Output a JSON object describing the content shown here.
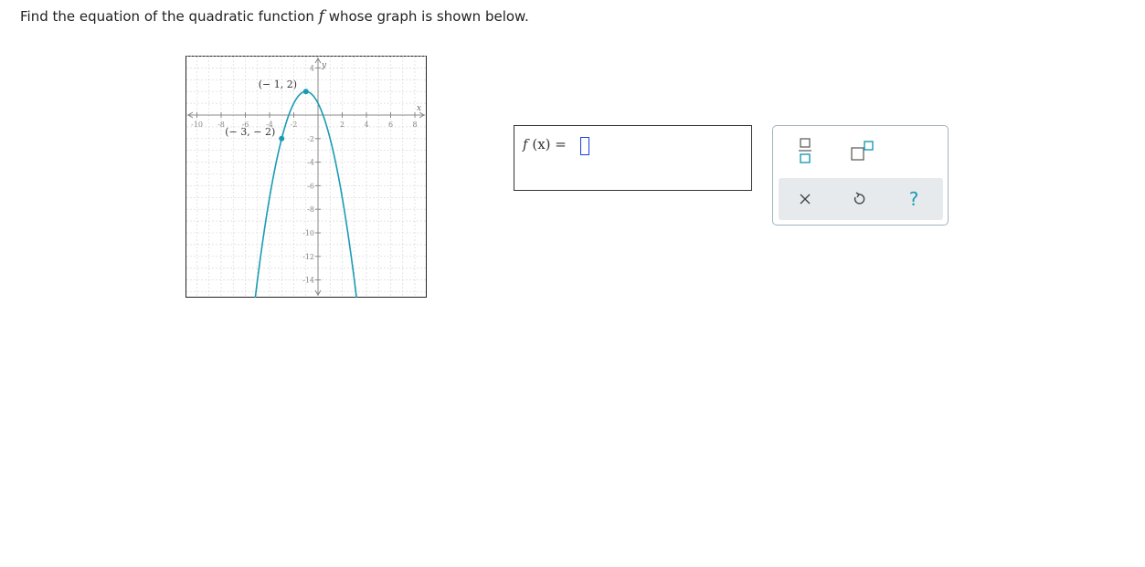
{
  "question": {
    "prefix": "Find the equation of the quadratic function ",
    "function_name": "f",
    "suffix": " whose graph is shown below."
  },
  "graph": {
    "axis_x_label": "x",
    "axis_y_label": "y",
    "x_tick_labels": [
      "-10",
      "-8",
      "-6",
      "-4",
      "-2",
      "2",
      "4",
      "6",
      "8"
    ],
    "y_tick_labels": [
      "4",
      "-2",
      "-4",
      "-6",
      "-8",
      "-10",
      "-12",
      "-14"
    ],
    "points": [
      {
        "label": "(− 1, 2)",
        "x": -1,
        "y": 2
      },
      {
        "label": "(− 3, − 2)",
        "x": -3,
        "y": -2
      }
    ],
    "curve_color": "#1a9bb4"
  },
  "answer": {
    "label_f": "f",
    "label_rest": "(x) =",
    "value": ""
  },
  "keypad": {
    "fraction_icon": "fraction-icon",
    "superscript_icon": "superscript-icon",
    "clear_icon": "clear-icon",
    "undo_icon": "undo-icon",
    "help_label": "?",
    "accent_color": "#1a9bb4"
  }
}
